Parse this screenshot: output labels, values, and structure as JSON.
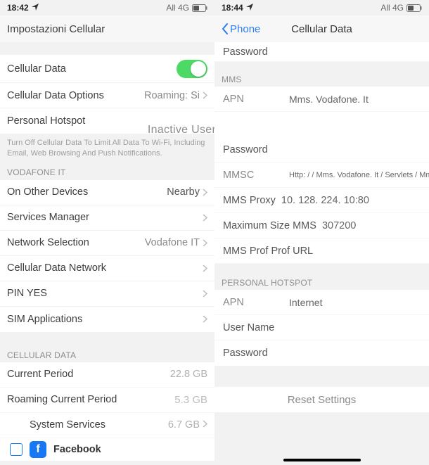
{
  "left": {
    "status": {
      "time": "18:42",
      "network": "All 4G"
    },
    "nav": {
      "title": "Impostazioni Cellular"
    },
    "cellularData": {
      "label": "Cellular Data"
    },
    "cellularDataOptions": {
      "label": "Cellular Data Options",
      "value": "Roaming: Si"
    },
    "personalHotspot": {
      "label": "Personal Hotspot"
    },
    "inactiveOverlay": "Inactive UserName",
    "hint": "Turn Off Cellular Data To Limit All Data To Wi-Fi, Including Email, Web Browsing And Push Notifications.",
    "carrierHeader": "VODAFONE IT",
    "onOtherDevices": {
      "label": "On Other Devices",
      "value": "Nearby"
    },
    "servicesManager": {
      "label": "Services Manager"
    },
    "networkSelection": {
      "label": "Network Selection",
      "value": "Vodafone IT"
    },
    "cellularDataNetwork": {
      "label": "Cellular Data Network"
    },
    "pinYes": {
      "label": "PIN YES"
    },
    "simApplications": {
      "label": "SIM Applications"
    },
    "dataHeader": "CELLULAR DATA",
    "currentPeriod": {
      "label": "Current Period",
      "value": "22.8 GB"
    },
    "roamingCurrentPeriod": {
      "label": "Roaming Current Period",
      "value": "5.3 GB"
    },
    "systemServices": {
      "label": "System Services",
      "value": "6.7 GB"
    },
    "facebook": {
      "label": "Facebook"
    }
  },
  "right": {
    "status": {
      "time": "18:44",
      "network": "All 4G"
    },
    "nav": {
      "back": "Phone",
      "title": "Cellular Data"
    },
    "topPassword": "Password",
    "mmsHeader": "MMS",
    "fields": {
      "apn": {
        "label": "APN",
        "value": "Mms. Vodafone. It"
      },
      "password": {
        "label": "Password",
        "value": ""
      },
      "mmsc": {
        "label": "MMSC",
        "value": "Http: / / Mms. Vodafone. It / Servlets / Mms"
      },
      "mmsProxy": {
        "label": "MMS Proxy",
        "value": "10. 128. 224. 10:80"
      },
      "maxSize": {
        "label": "Maximum Size MMS",
        "value": "307200"
      },
      "mmsProfUrl": {
        "label": "MMS Prof Prof URL",
        "value": ""
      }
    },
    "hotspotHeader": "PERSONAL HOTSPOT",
    "hotspot": {
      "apn": {
        "label": "APN",
        "value": "Internet"
      },
      "user": {
        "label": "User Name",
        "value": ""
      },
      "password": {
        "label": "Password",
        "value": ""
      }
    },
    "reset": "Reset Settings"
  }
}
